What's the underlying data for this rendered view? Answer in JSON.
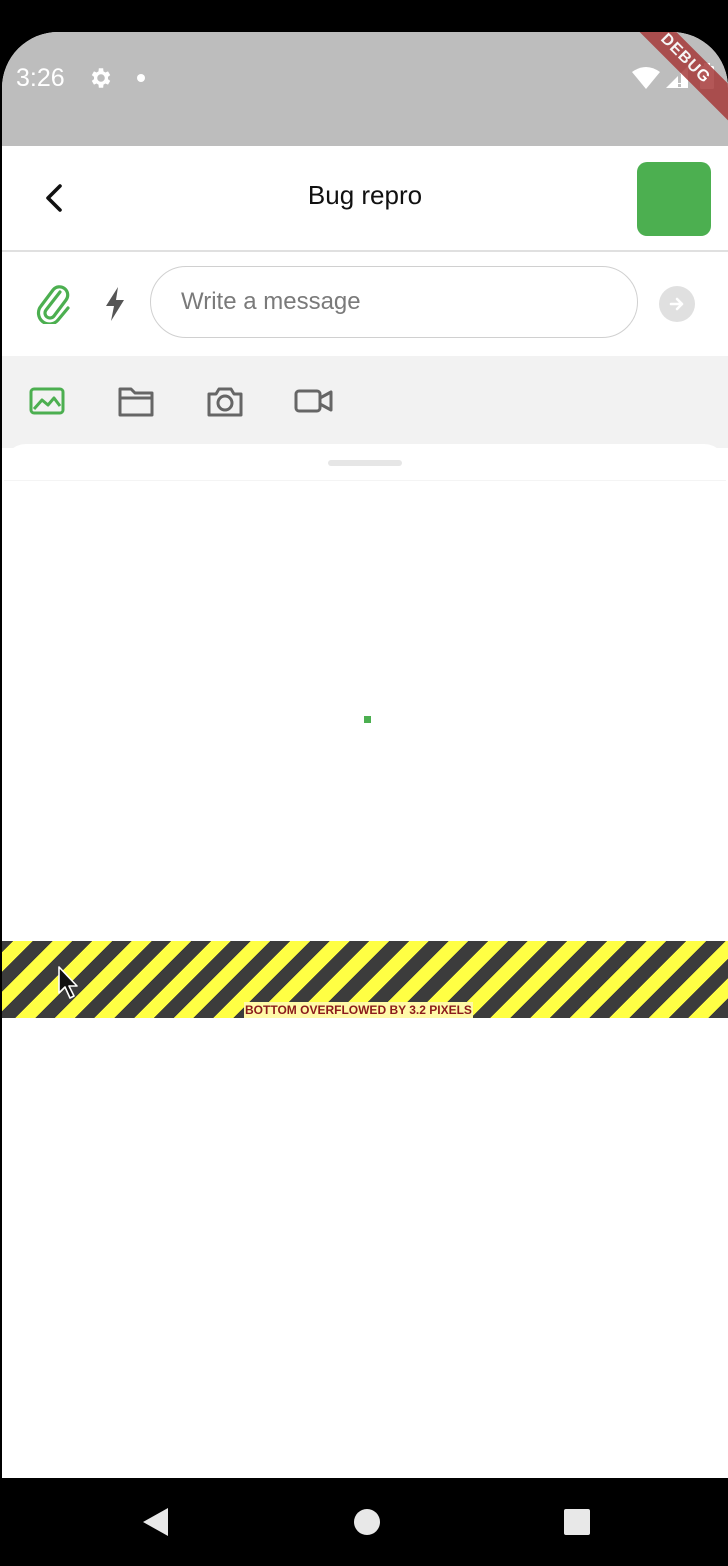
{
  "status_bar": {
    "time": "3:26",
    "debug_label": "DEBUG",
    "background": "#bdbdbd"
  },
  "app_bar": {
    "title": "Bug repro",
    "avatar_color": "#4caf50"
  },
  "composer": {
    "placeholder": "Write a message",
    "value": ""
  },
  "media_tabs": [
    {
      "icon": "image-icon",
      "selected": true
    },
    {
      "icon": "folder-icon",
      "selected": false
    },
    {
      "icon": "camera-icon",
      "selected": false
    },
    {
      "icon": "video-icon",
      "selected": false
    }
  ],
  "overflow": {
    "message": "BOTTOM OVERFLOWED BY 3.2 PIXELS"
  },
  "colors": {
    "accent": "#4caf50",
    "overflow_yellow": "#ffff44",
    "overflow_dark": "#3c3c3c",
    "overflow_text": "#8b1a1a"
  },
  "nav_bar": {
    "buttons": [
      "back-icon",
      "home-icon",
      "recents-icon"
    ]
  }
}
